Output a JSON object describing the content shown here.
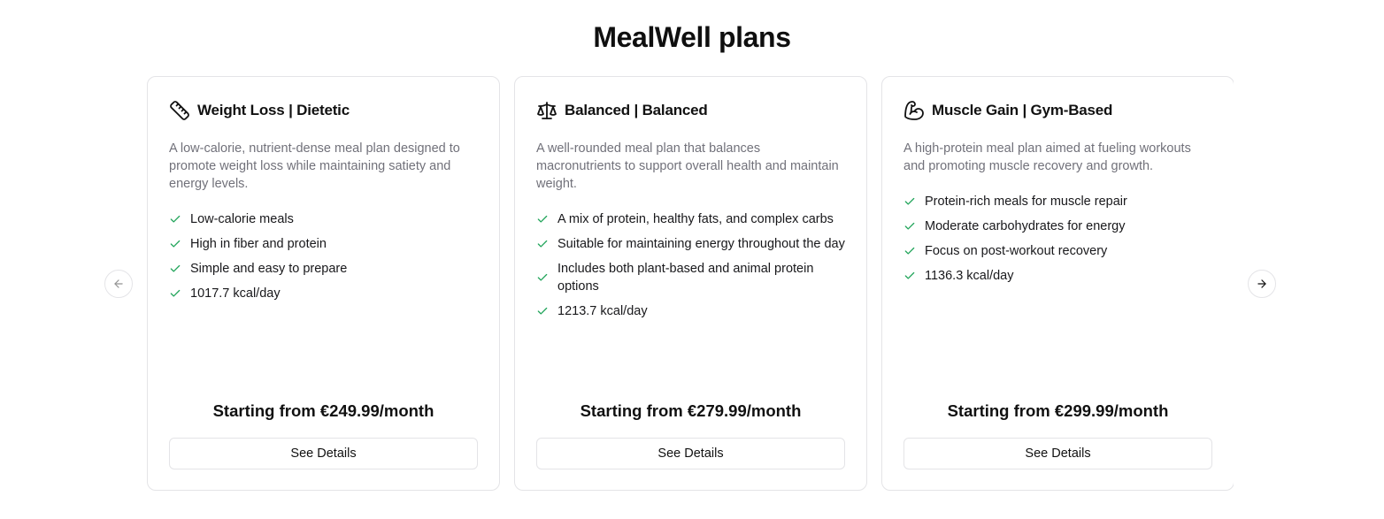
{
  "page": {
    "title": "MealWell plans"
  },
  "plans": [
    {
      "title": "Weight Loss | Dietetic",
      "icon": "ruler-icon",
      "description": "A low-calorie, nutrient-dense meal plan designed to promote weight loss while maintaining satiety and energy levels.",
      "features": [
        "Low-calorie meals",
        "High in fiber and protein",
        "Simple and easy to prepare",
        "1017.7 kcal/day"
      ],
      "price": "Starting from €249.99/month",
      "button_label": "See Details"
    },
    {
      "title": "Balanced | Balanced",
      "icon": "scale-icon",
      "description": "A well-rounded meal plan that balances macronutrients to support overall health and maintain weight.",
      "features": [
        "A mix of protein, healthy fats, and complex carbs",
        "Suitable for maintaining energy throughout the day",
        "Includes both plant-based and animal protein options",
        "1213.7 kcal/day"
      ],
      "price": "Starting from €279.99/month",
      "button_label": "See Details"
    },
    {
      "title": "Muscle Gain | Gym-Based",
      "icon": "biceps-flexed-icon",
      "description": "A high-protein meal plan aimed at fueling workouts and promoting muscle recovery and growth.",
      "features": [
        "Protein-rich meals for muscle repair",
        "Moderate carbohydrates for energy",
        "Focus on post-workout recovery",
        "1136.3 kcal/day"
      ],
      "price": "Starting from €299.99/month",
      "button_label": "See Details"
    }
  ],
  "navigation": {
    "prev_icon": "arrow-left-icon",
    "next_icon": "arrow-right-icon"
  },
  "colors": {
    "check": "#22a55b",
    "muted_text": "#71717a",
    "border": "#e4e4e7"
  }
}
